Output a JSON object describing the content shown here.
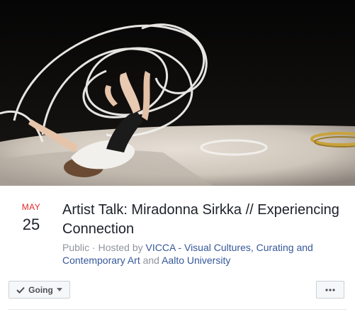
{
  "event": {
    "month": "MAY",
    "day": "25",
    "title": "Artist Talk: Miradonna Sirkka // Experiencing Connection",
    "privacy": "Public",
    "hosted_by_prefix": "Hosted by",
    "host_1": "VICCA - Visual Cultures, Curating and Contemporary Art",
    "and": "and",
    "host_2": "Aalto University"
  },
  "actions": {
    "going_label": "Going",
    "more_icon": "more-icon"
  },
  "colors": {
    "month": "#e02a2a",
    "link": "#365899",
    "muted": "#90949c"
  }
}
